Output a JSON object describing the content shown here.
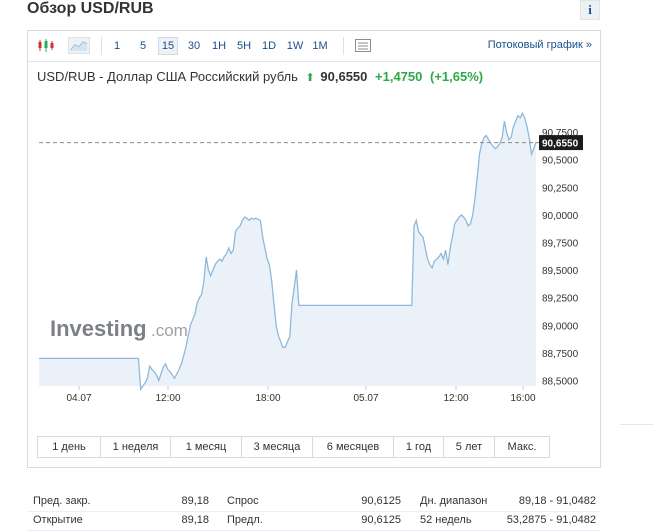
{
  "page": {
    "title": "Обзор USD/RUB",
    "info_label": "i"
  },
  "toolbar": {
    "icons": [
      "candlestick-icon",
      "area-chart-icon",
      "settings-panel-icon"
    ],
    "timeframes": [
      "1",
      "5",
      "15",
      "30",
      "1H",
      "5H",
      "1D",
      "1W",
      "1M"
    ],
    "active_timeframe": "15",
    "stream_link": "Потоковый график »"
  },
  "instrument": {
    "name": "USD/RUB - Доллар США Российский рубль",
    "arrow": "⬆",
    "price": "90,6550",
    "change": "+1,4750",
    "change_pct": "(+1,65%)"
  },
  "chart_data": {
    "type": "area",
    "title": "",
    "xlabel": "",
    "ylabel": "",
    "x_ticks": [
      "04.07",
      "12:00",
      "18:00",
      "05.07",
      "12:00",
      "16:00"
    ],
    "y_ticks": [
      "90,7500",
      "90,5000",
      "90,2500",
      "90,0000",
      "89,7500",
      "89,5000",
      "89,2500",
      "89,0000",
      "88,7500",
      "88,5000"
    ],
    "ylim": [
      88.45,
      91.05
    ],
    "current_value_label": "90,6550",
    "current_value": 90.655,
    "watermark": "Investing.com",
    "colors": {
      "line": "#8fb9dc",
      "fill": "#e6eff7",
      "current_marker": "#1c1c1c",
      "dash": "#8a8a8a"
    },
    "series": [
      {
        "values": [
          88.7,
          88.7,
          88.7,
          88.7,
          88.7,
          88.7,
          88.7,
          88.7,
          88.7,
          88.7,
          88.7,
          88.7,
          88.7,
          88.7,
          88.7,
          88.7,
          88.7,
          88.7,
          88.7,
          88.7,
          88.7,
          88.7,
          88.7,
          88.7,
          88.7,
          88.7,
          88.7,
          88.7,
          88.7,
          88.7,
          88.7,
          88.7,
          88.7,
          88.7,
          88.7,
          88.7,
          88.7,
          88.7,
          88.7,
          88.7,
          88.7,
          88.7,
          88.7,
          88.7,
          88.7,
          88.42,
          88.45,
          88.48,
          88.52,
          88.63,
          88.6,
          88.58,
          88.55,
          88.5,
          88.56,
          88.62,
          88.65,
          88.6,
          88.58,
          88.55,
          88.52,
          88.56,
          88.6,
          88.65,
          88.72,
          88.8,
          88.9,
          89.0,
          89.05,
          89.1,
          89.2,
          89.25,
          89.28,
          89.4,
          89.62,
          89.5,
          89.45,
          89.5,
          89.55,
          89.58,
          89.6,
          89.58,
          89.62,
          89.65,
          89.7,
          89.65,
          89.68,
          89.85,
          89.88,
          89.9,
          89.95,
          89.98,
          89.97,
          89.95,
          89.97,
          89.96,
          89.97,
          89.96,
          89.95,
          89.8,
          89.7,
          89.6,
          89.55,
          89.4,
          89.2,
          89.0,
          88.9,
          88.85,
          88.8,
          88.8,
          88.85,
          88.9,
          89.2,
          89.35,
          89.5,
          89.18,
          89.18,
          89.18,
          89.18,
          89.18,
          89.18,
          89.18,
          89.18,
          89.18,
          89.18,
          89.18,
          89.18,
          89.18,
          89.18,
          89.18,
          89.18,
          89.18,
          89.18,
          89.18,
          89.18,
          89.18,
          89.18,
          89.18,
          89.18,
          89.18,
          89.18,
          89.18,
          89.18,
          89.18,
          89.18,
          89.18,
          89.18,
          89.18,
          89.18,
          89.18,
          89.18,
          89.18,
          89.18,
          89.18,
          89.18,
          89.18,
          89.18,
          89.18,
          89.18,
          89.18,
          89.18,
          89.18,
          89.18,
          89.18,
          89.18,
          89.18,
          89.9,
          89.95,
          89.85,
          89.82,
          89.8,
          89.7,
          89.6,
          89.55,
          89.52,
          89.58,
          89.6,
          89.62,
          89.65,
          89.6,
          89.68,
          89.55,
          89.7,
          89.8,
          89.92,
          89.95,
          89.98,
          90.0,
          89.98,
          89.95,
          89.9,
          89.92,
          90.0,
          90.15,
          90.35,
          90.55,
          90.65,
          90.7,
          90.72,
          90.68,
          90.65,
          90.62,
          90.6,
          90.62,
          90.65,
          90.7,
          90.85,
          90.75,
          90.68,
          90.7,
          90.8,
          90.85,
          90.9,
          90.88,
          90.92,
          90.88,
          90.8,
          90.7,
          90.55,
          90.6,
          90.66
        ]
      }
    ]
  },
  "periods": [
    "1 день",
    "1 неделя",
    "1 месяц",
    "3 месяца",
    "6 месяцев",
    "1 год",
    "5 лет",
    "Макс."
  ],
  "stats": [
    {
      "label1": "Пред. закр.",
      "value1": "89,18",
      "label2": "Спрос",
      "value2": "90,6125",
      "label3": "Дн. диапазон",
      "value3": "89,18 - 91,0482"
    },
    {
      "label1": "Открытие",
      "value1": "89,18",
      "label2": "Предл.",
      "value2": "90,6125",
      "label3": "52 недель",
      "value3": "53,2875 - 91,0482"
    }
  ]
}
